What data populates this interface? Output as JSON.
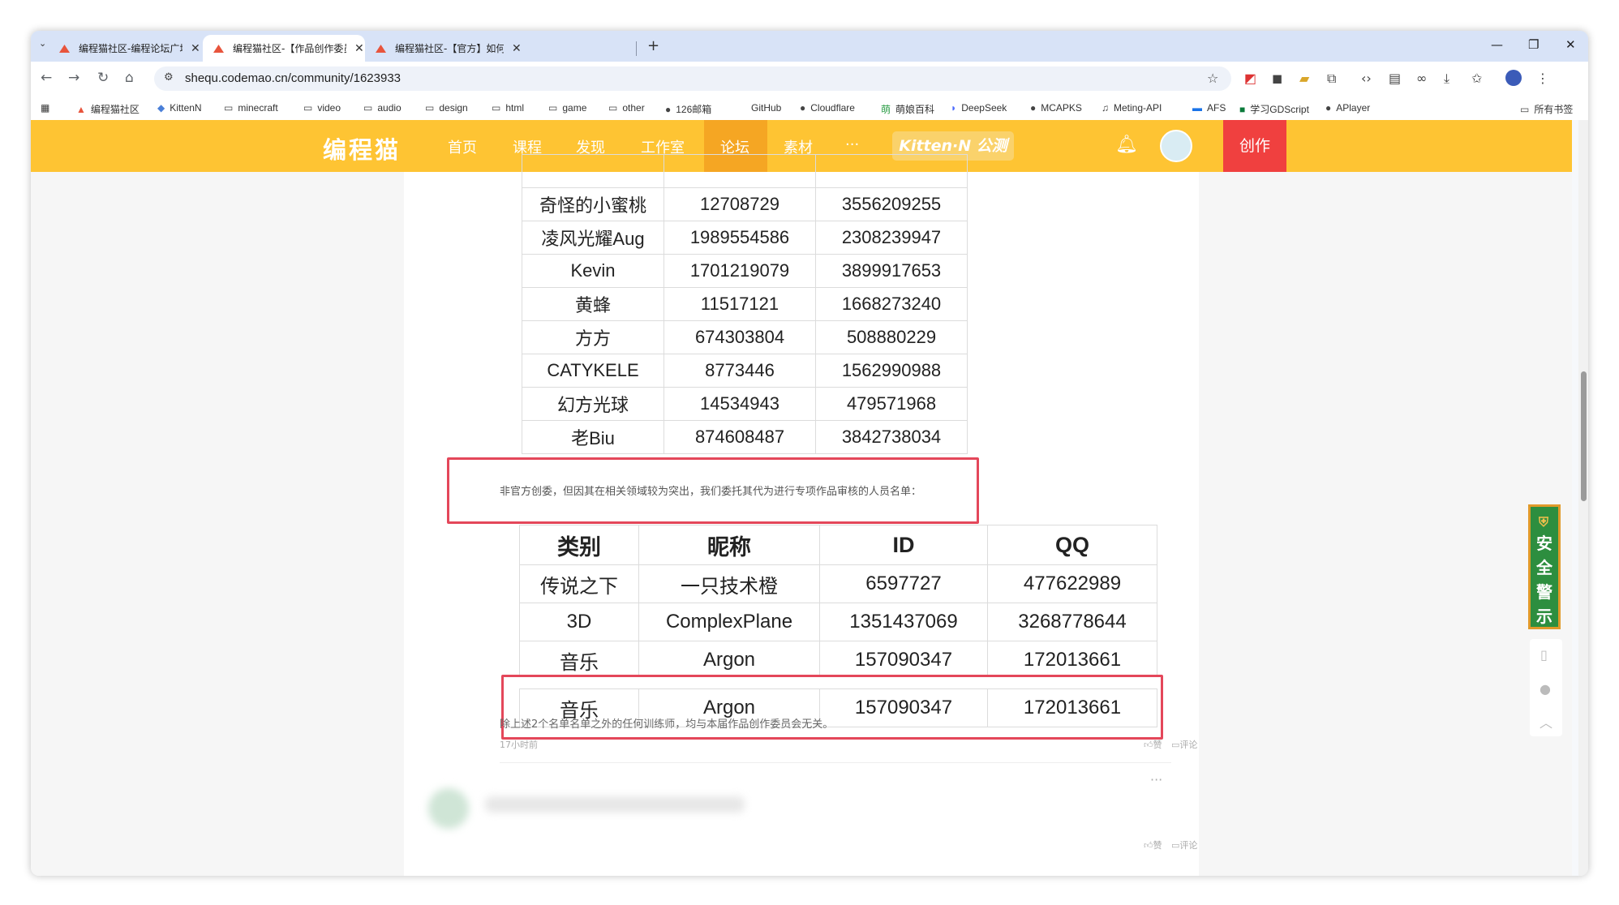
{
  "browser": {
    "tabs": [
      {
        "title": "编程猫社区-编程论坛广场-编程",
        "active": false
      },
      {
        "title": "编程猫社区-【作品创作委员会】",
        "active": true
      },
      {
        "title": "编程猫社区-【官方】如何上首页",
        "active": false
      }
    ],
    "new_tab": "+",
    "url": "shequ.codemao.cn/community/1623933",
    "bookmarks": [
      {
        "label": "编程猫社区",
        "icon": "codemao-icon"
      },
      {
        "label": "KittenN",
        "icon": "kitten-icon"
      },
      {
        "label": "minecraft",
        "icon": "folder-icon"
      },
      {
        "label": "video",
        "icon": "folder-icon"
      },
      {
        "label": "audio",
        "icon": "folder-icon"
      },
      {
        "label": "design",
        "icon": "folder-icon"
      },
      {
        "label": "html",
        "icon": "folder-icon"
      },
      {
        "label": "game",
        "icon": "folder-icon"
      },
      {
        "label": "other",
        "icon": "folder-icon"
      },
      {
        "label": "126邮箱",
        "icon": "globe-icon"
      },
      {
        "label": "GitHub",
        "icon": "github-icon"
      },
      {
        "label": "Cloudflare",
        "icon": "globe-icon"
      },
      {
        "label": "萌娘百科",
        "icon": "moegirl-icon"
      },
      {
        "label": "DeepSeek",
        "icon": "deepseek-icon"
      },
      {
        "label": "MCAPKS",
        "icon": "globe-icon"
      },
      {
        "label": "Meting-API",
        "icon": "music-icon"
      },
      {
        "label": "AFS",
        "icon": "afs-icon"
      },
      {
        "label": "学习GDScript",
        "icon": "gdscript-icon"
      },
      {
        "label": "APlayer",
        "icon": "globe-icon"
      }
    ],
    "all_bookmarks": "所有书签"
  },
  "site": {
    "logo": "编程猫",
    "nav": [
      "首页",
      "课程",
      "发现",
      "工作室",
      "论坛",
      "素材",
      "···"
    ],
    "active_nav": "论坛",
    "kitten_badge": "Kitten·N 公测",
    "create_label": "创作"
  },
  "post": {
    "table1_rows": [
      [
        "奇怪的小蜜桃",
        "12708729",
        "3556209255"
      ],
      [
        "凌风光耀Aug",
        "1989554586",
        "2308239947"
      ],
      [
        "Kevin",
        "1701219079",
        "3899917653"
      ],
      [
        "黄蜂",
        "11517121",
        "1668273240"
      ],
      [
        "方方",
        "674303804",
        "508880229"
      ],
      [
        "CATYKELE",
        "8773446",
        "1562990988"
      ],
      [
        "幻方光球",
        "14534943",
        "479571968"
      ],
      [
        "老Biu",
        "874608487",
        "3842738034"
      ]
    ],
    "note": "非官方创委，但因其在相关领域较为突出，我们委托其代为进行专项作品审核的人员名单：",
    "table2_headers": [
      "类别",
      "昵称",
      "ID",
      "QQ"
    ],
    "table2_rows": [
      [
        "传说之下",
        "一只技术橙",
        "6597727",
        "477622989"
      ],
      [
        "3D",
        "ComplexPlane",
        "1351437069",
        "3268778644"
      ],
      [
        "音乐",
        "Argon",
        "157090347",
        "172013661"
      ]
    ],
    "footer_text": "除上述2个名单名单之外的任何训练师，均与本届作品创作委员会无关。",
    "time": "17小时前",
    "like": "赞",
    "comment": "评论"
  },
  "side": {
    "safety": [
      "安",
      "全",
      "警",
      "示"
    ]
  },
  "colors": {
    "brand_yellow": "#fec433",
    "create_red": "#f0403f",
    "highlight": "#e4475a",
    "safety_green": "#2d8e3f"
  }
}
